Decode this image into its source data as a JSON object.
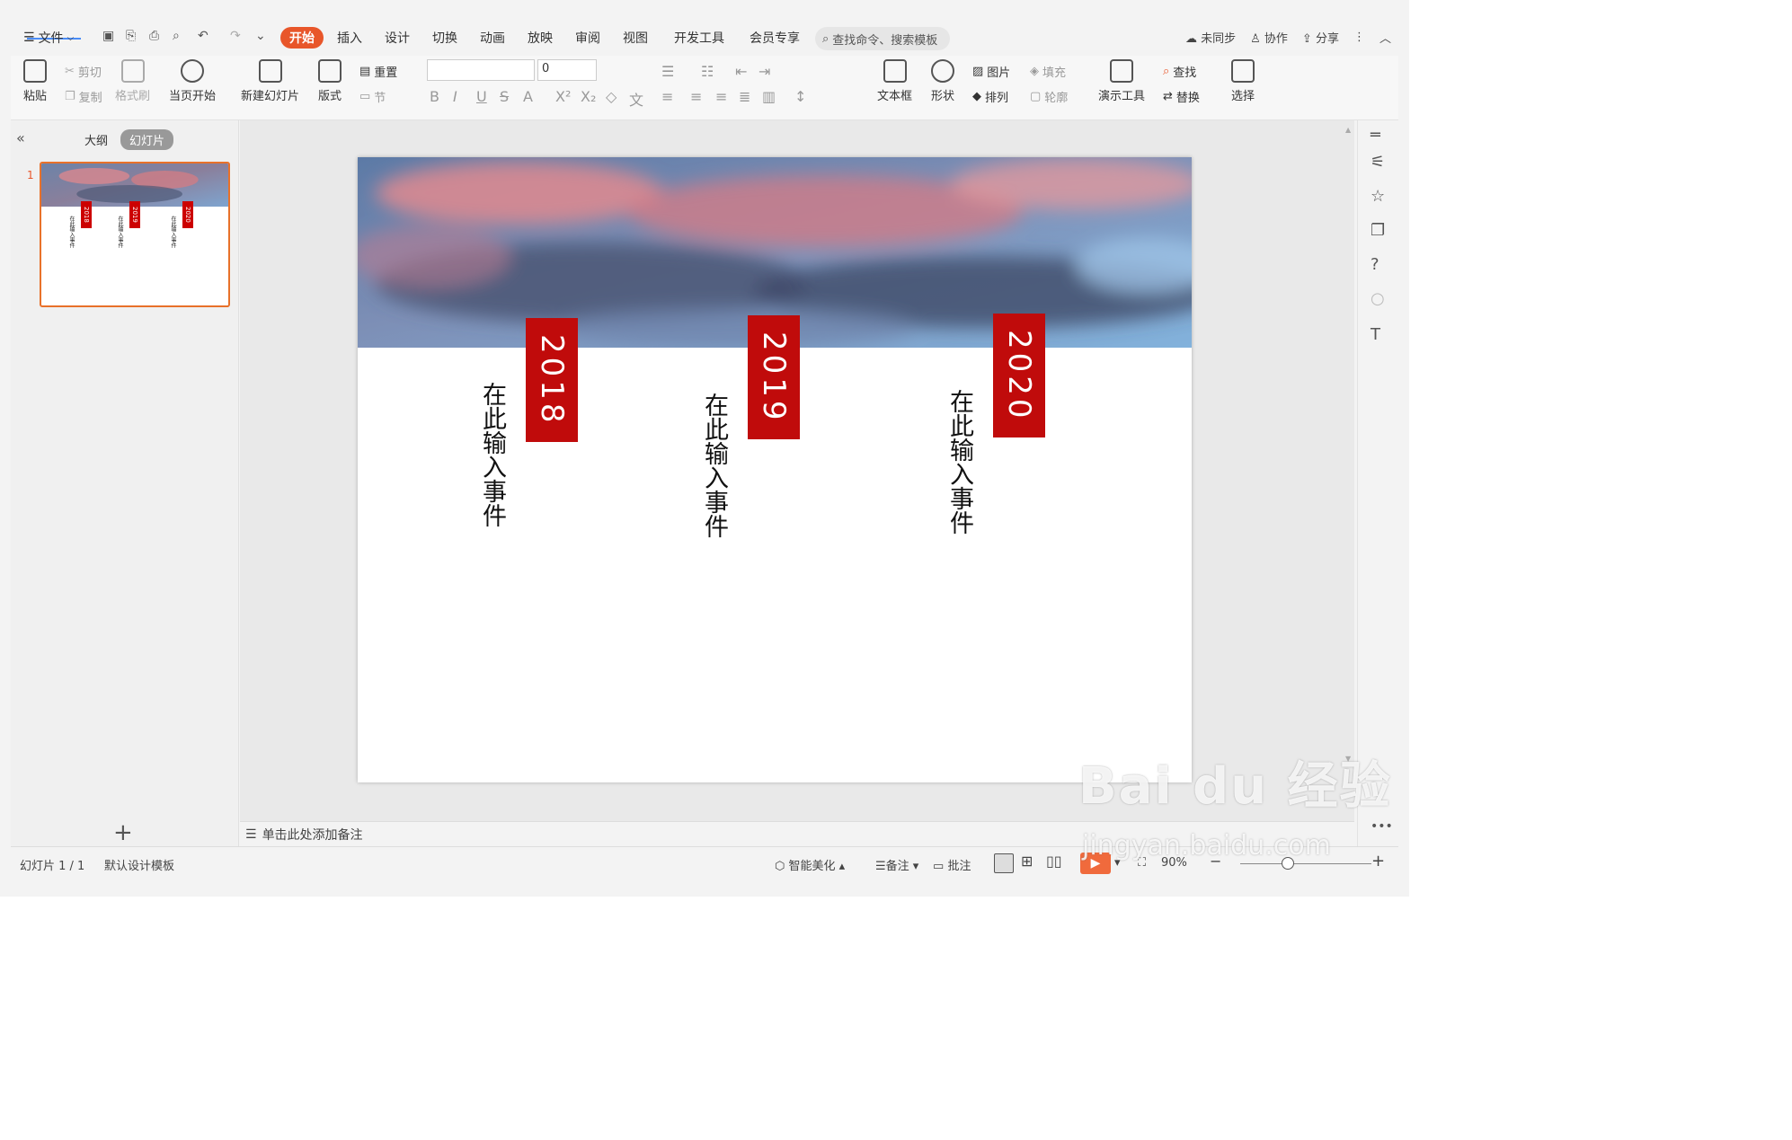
{
  "menu": {
    "file": "文件"
  },
  "tabs": [
    {
      "label": "开始",
      "active": true
    },
    {
      "label": "插入"
    },
    {
      "label": "设计"
    },
    {
      "label": "切换"
    },
    {
      "label": "动画"
    },
    {
      "label": "放映"
    },
    {
      "label": "审阅"
    },
    {
      "label": "视图"
    },
    {
      "label": "开发工具"
    },
    {
      "label": "会员专享"
    }
  ],
  "search": {
    "placeholder": "查找命令、搜索模板"
  },
  "header_actions": {
    "sync": "未同步",
    "collab": "协作",
    "share": "分享"
  },
  "ribbon": {
    "paste": "粘贴",
    "cut": "剪切",
    "copy": "复制",
    "format_painter": "格式刷",
    "play_from_current": "当页开始",
    "new_slide": "新建幻灯片",
    "layout": "版式",
    "reset": "重置",
    "section": "节",
    "font_size": "0",
    "textbox": "文本框",
    "shape": "形状",
    "picture": "图片",
    "fill": "填充",
    "arrange": "排列",
    "outline": "轮廓",
    "presentation_tools": "演示工具",
    "find": "查找",
    "replace": "替换",
    "select": "选择"
  },
  "left_panel": {
    "outline_tab": "大纲",
    "slides_tab": "幻灯片",
    "slide_number": "1"
  },
  "slide": {
    "items": [
      {
        "year": "2018",
        "text": "在此输入事件"
      },
      {
        "year": "2019",
        "text": "在此输入事件"
      },
      {
        "year": "2020",
        "text": "在此输入事件"
      }
    ]
  },
  "notes": {
    "placeholder": "单击此处添加备注"
  },
  "status": {
    "slide_count": "幻灯片 1 / 1",
    "template": "默认设计模板",
    "beautify": "智能美化",
    "notes": "备注",
    "comments": "批注",
    "zoom": "90%"
  },
  "watermark": {
    "brand": "Bai du 经验",
    "url": "jingyan.baidu.com"
  },
  "colors": {
    "accent": "#e8562a",
    "badge": "#c00b0b"
  }
}
